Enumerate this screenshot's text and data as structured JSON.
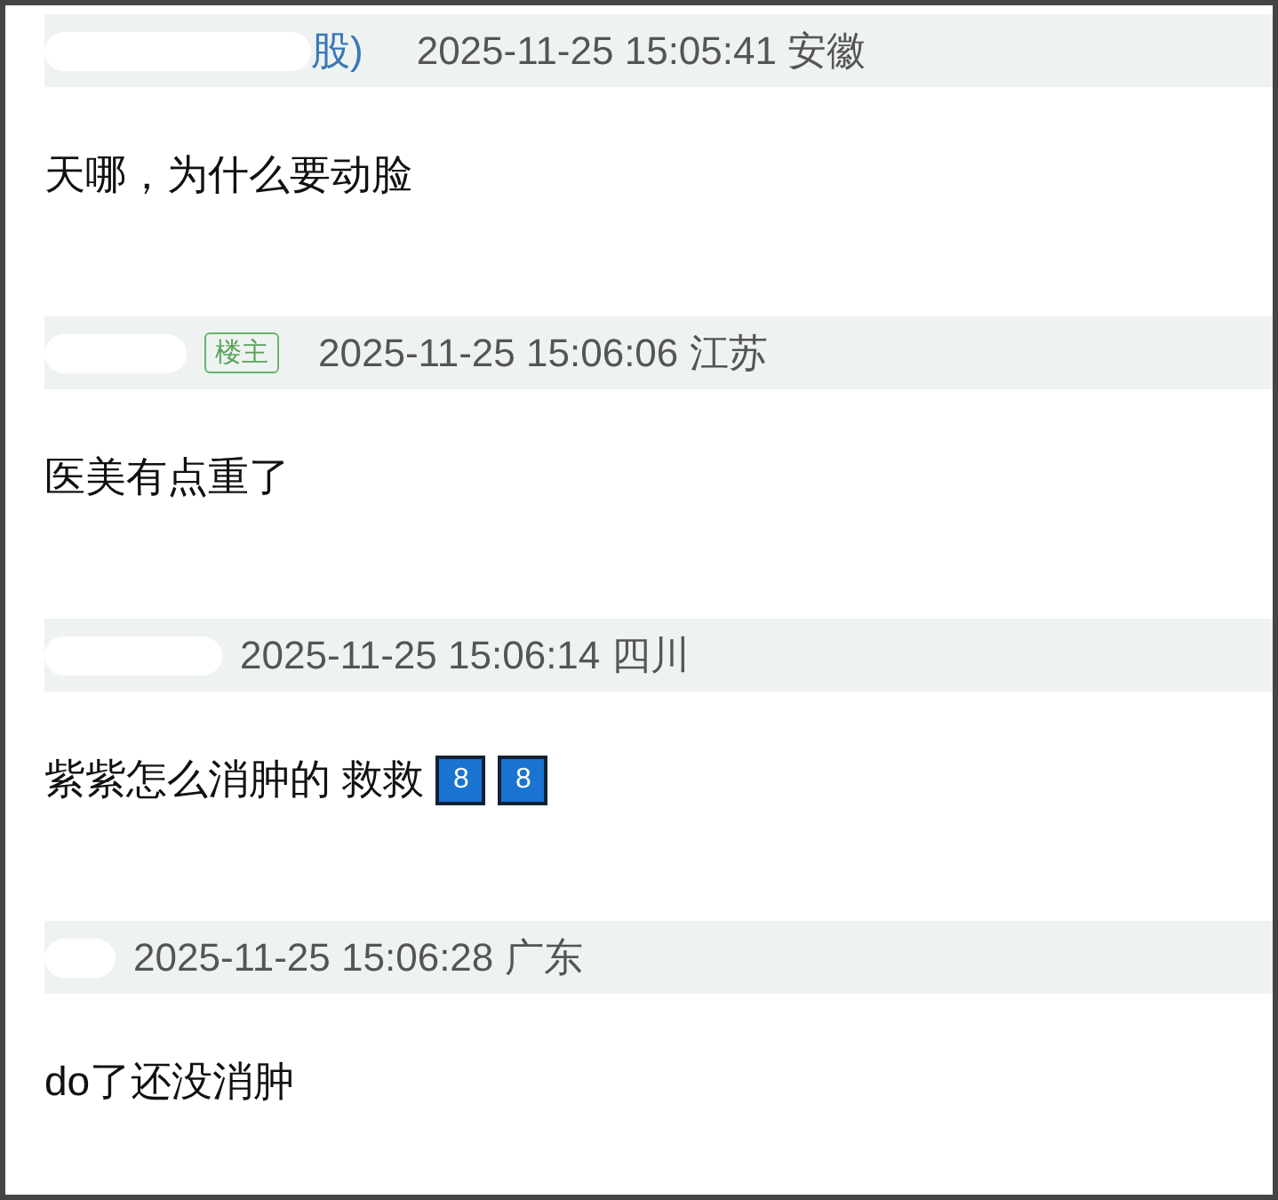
{
  "comments": [
    {
      "user_fragment": "股)",
      "time": "2025-11-25 15:05:41",
      "location": "安徽",
      "content": "天哪，为什么要动脸"
    },
    {
      "op_label": "楼主",
      "time": "2025-11-25 15:06:06",
      "location": "江苏",
      "content": "医美有点重了"
    },
    {
      "time": "2025-11-25 15:06:14",
      "location": "四川",
      "content": "紫紫怎么消肿的 救救",
      "keycaps": [
        "8",
        "8"
      ]
    },
    {
      "time": "2025-11-25 15:06:28",
      "location": "广东",
      "content": "do了还没消肿"
    }
  ]
}
